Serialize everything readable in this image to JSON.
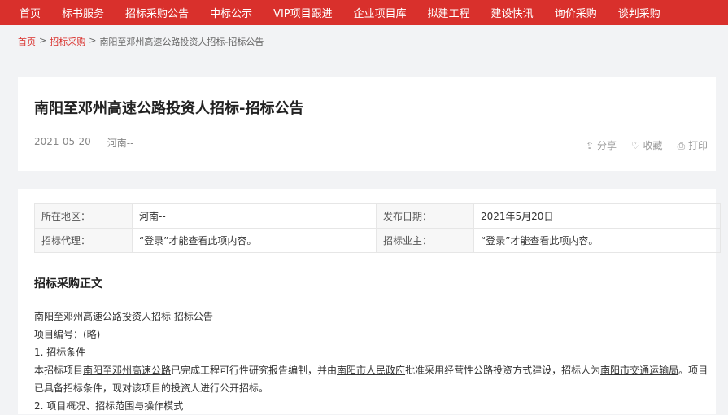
{
  "nav": [
    "首页",
    "标书服务",
    "招标采购公告",
    "中标公示",
    "VIP项目跟进",
    "企业项目库",
    "拟建工程",
    "建设快讯",
    "询价采购",
    "谈判采购"
  ],
  "breadcrumb": {
    "home": "首页",
    "section": "招标采购",
    "current": "南阳至邓州高速公路投资人招标-招标公告",
    "sep": ">"
  },
  "article": {
    "title": "南阳至邓州高速公路投资人招标-招标公告",
    "date": "2021-05-20",
    "region": "河南--",
    "actions": {
      "share": "分享",
      "favorite": "收藏",
      "print": "打印"
    }
  },
  "info": {
    "region_label": "所在地区：",
    "region": "河南--",
    "date_label": "发布日期：",
    "date": "2021年5月20日",
    "agent_label": "招标代理：",
    "agent": "“登录”才能查看此项内容。",
    "owner_label": "招标业主：",
    "owner": "“登录”才能查看此项内容。"
  },
  "content": {
    "heading": "招标采购正文",
    "line1": "南阳至邓州高速公路投资人招标 招标公告",
    "line2": "项目编号：(略)",
    "line3": "1. 招标条件",
    "p_a": "本招标项目",
    "p_link1": "南阳至邓州高速公路",
    "p_b": "已完成工程可行性研究报告编制，并由",
    "p_link2": "南阳市人民政府",
    "p_c": "批准采用经营性公路投资方式建设，招标人为",
    "p_link3": "南阳市交通运输局",
    "p_d": "。项目已具备招标条件，现对该项目的投资人进行公开招标。",
    "line5": "2. 项目概况、招标范围与操作模式"
  }
}
